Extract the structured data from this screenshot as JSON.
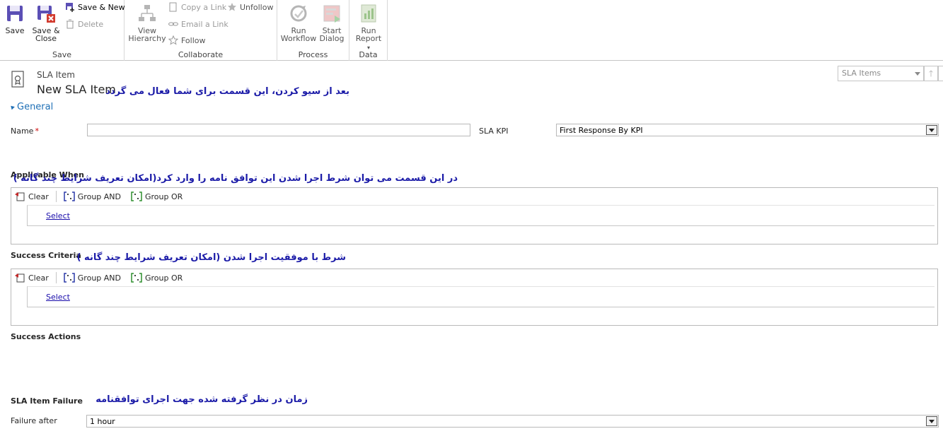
{
  "ribbon": {
    "save_group": {
      "label": "Save",
      "save": "Save",
      "save_close_line1": "Save &",
      "save_close_line2": "Close",
      "save_new": "Save & New",
      "delete": "Delete"
    },
    "collaborate_group": {
      "label": "Collaborate",
      "view_hierarchy_line1": "View",
      "view_hierarchy_line2": "Hierarchy",
      "copy_link": "Copy a Link",
      "email_link": "Email a Link",
      "follow": "Follow",
      "unfollow": "Unfollow"
    },
    "process_group": {
      "label": "Process",
      "run_workflow_line1": "Run",
      "run_workflow_line2": "Workflow",
      "start_dialog_line1": "Start",
      "start_dialog_line2": "Dialog"
    },
    "data_group": {
      "label": "Data",
      "run_report_line1": "Run",
      "run_report_line2": "Report"
    }
  },
  "header": {
    "entity_type": "SLA Item",
    "title": "New SLA Item",
    "nav_select": "SLA Items"
  },
  "annotations": {
    "after_save": "بعد از سیو کردن، این قسمت برای شما فعال می گردد",
    "applicable_when": "در این قسمت می توان شرط اجرا شدن این توافق نامه را وارد کرد(امکان تعریف شرایط چند گانه )",
    "success_criteria": "شرط با موفقیت اجرا شدن (امکان تعریف شرایط چند گانه )",
    "failure": "زمان در نظر گرفته شده جهت اجرای توافقنامه"
  },
  "general": {
    "section_title": "General",
    "name_label": "Name",
    "name_required": "*",
    "name_value": "",
    "sla_kpi_label": "SLA KPI",
    "sla_kpi_value": "First Response By KPI"
  },
  "applicable_when": {
    "label": "Applicable When",
    "clear": "Clear",
    "group_and": "Group AND",
    "group_or": "Group OR",
    "select": "Select"
  },
  "success_criteria": {
    "label": "Success Criteria",
    "clear": "Clear",
    "group_and": "Group AND",
    "group_or": "Group OR",
    "select": "Select"
  },
  "success_actions": {
    "label": "Success Actions"
  },
  "failure": {
    "section_label": "SLA Item Failure",
    "failure_after_label": "Failure after",
    "failure_after_value": "1 hour"
  },
  "colors": {
    "annotation": "#1c1ca8",
    "section_header": "#1e6fb6",
    "link": "#1a0dab",
    "required": "#cc0000"
  }
}
